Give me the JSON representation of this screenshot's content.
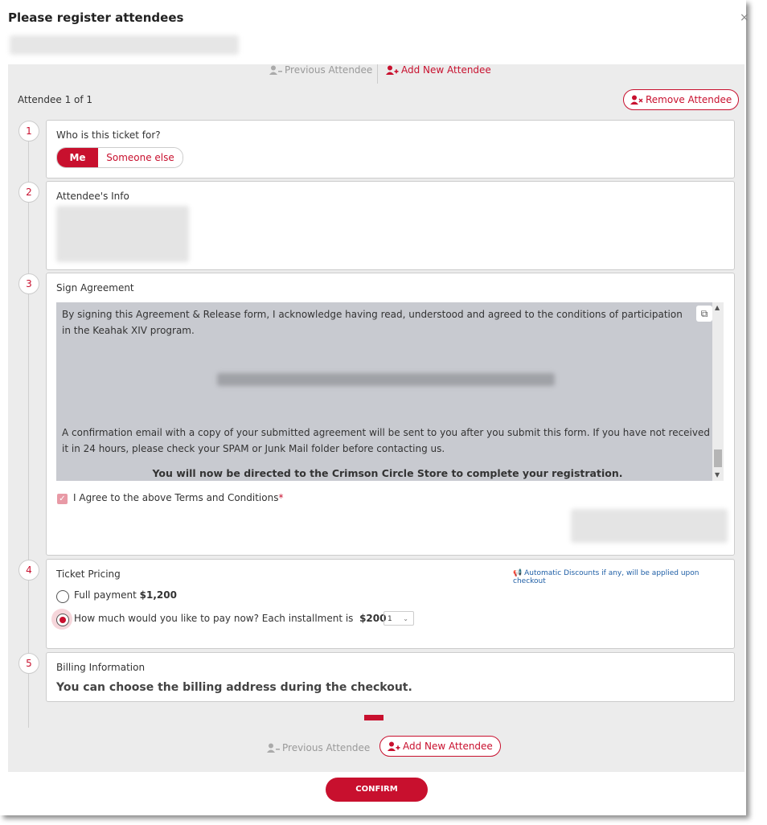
{
  "modal": {
    "title": "Please register attendees",
    "close_icon": "close-icon"
  },
  "nav": {
    "prev_label": "Previous Attendee",
    "add_label": "Add New Attendee",
    "prev_icon": "user-minus-icon",
    "add_icon": "user-plus-icon"
  },
  "attendee": {
    "count_label": "Attendee 1 of 1",
    "remove_label": "Remove Attendee",
    "remove_icon": "user-remove-icon"
  },
  "steps": {
    "n1": "1",
    "n2": "2",
    "n3": "3",
    "n4": "4",
    "n5": "5"
  },
  "ticket_for": {
    "title": "Who is this ticket for?",
    "option_me": "Me",
    "option_else": "Someone else",
    "selected": "Me"
  },
  "attendee_info": {
    "title": "Attendee's Info"
  },
  "agreement": {
    "title": "Sign Agreement",
    "para1": "By signing this Agreement & Release form, I acknowledge having read, understood and agreed to the conditions of participation in the Keahak XIV program.",
    "para2": "A confirmation email with a copy of your submitted agreement will be sent to you after you submit this form. If you have not received it in 24 hours, please check your SPAM or Junk Mail folder before contacting us.",
    "para3": "You will now be directed to the Crimson Circle Store to complete your registration.",
    "checkbox_label": "I Agree to the above Terms and Conditions",
    "required_mark": "*",
    "checked": true,
    "external_icon": "external-link-icon"
  },
  "pricing": {
    "title": "Ticket Pricing",
    "note": "Automatic Discounts if any, will be applied upon checkout",
    "note_icon": "megaphone-icon",
    "full_label": "Full payment",
    "full_amount": "$1,200",
    "installment_label": "How much would you like to pay now? Each installment is",
    "installment_amount": "$200",
    "installment_count": "1",
    "selected": "installment"
  },
  "billing": {
    "title": "Billing Information",
    "message": "You can choose the billing address during the checkout."
  },
  "footer": {
    "confirm_label": "CONFIRM"
  },
  "colors": {
    "accent": "#c8102e",
    "panel_bg": "#ececec",
    "note_blue": "#1f5fa6"
  }
}
